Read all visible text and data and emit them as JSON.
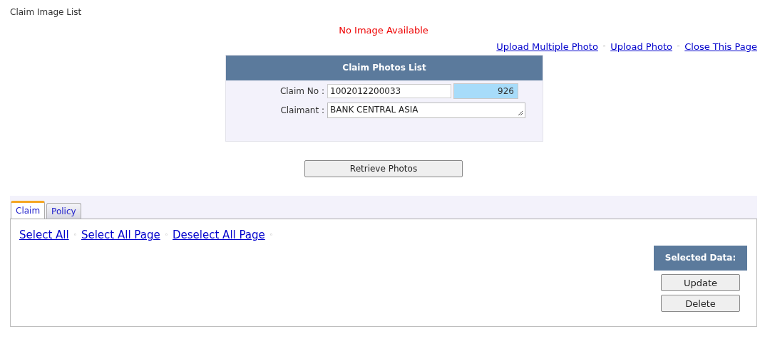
{
  "page_title": "Claim Image List",
  "notice": "No Image Available",
  "top_links": [
    {
      "kind": "link",
      "label": "Upload Multiple Photo"
    },
    {
      "kind": "separator",
      "label": "◦"
    },
    {
      "kind": "link",
      "label": "Upload Photo"
    },
    {
      "kind": "separator",
      "label": "◦"
    },
    {
      "kind": "link",
      "label": "Close This Page"
    }
  ],
  "panel": {
    "title": "Claim Photos List",
    "claim_no": {
      "label": "Claim No :",
      "value": "1002012200033",
      "count": "926"
    },
    "claimant": {
      "label": "Claimant :",
      "value": "BANK CENTRAL ASIA"
    }
  },
  "retrieve_button": "Retrieve Photos",
  "tabs": [
    {
      "label": "Claim",
      "selected": true
    },
    {
      "label": "Policy",
      "selected": false
    }
  ],
  "selection_links": [
    {
      "kind": "link",
      "label": "Select All"
    },
    {
      "kind": "separator",
      "label": "◦"
    },
    {
      "kind": "link",
      "label": "Select All Page"
    },
    {
      "kind": "separator",
      "label": "◦"
    },
    {
      "kind": "link",
      "label": "Deselect All Page"
    },
    {
      "kind": "separator",
      "label": "◦"
    }
  ],
  "selected_data": {
    "title": "Selected Data:",
    "buttons": [
      "Update",
      "Delete"
    ]
  }
}
